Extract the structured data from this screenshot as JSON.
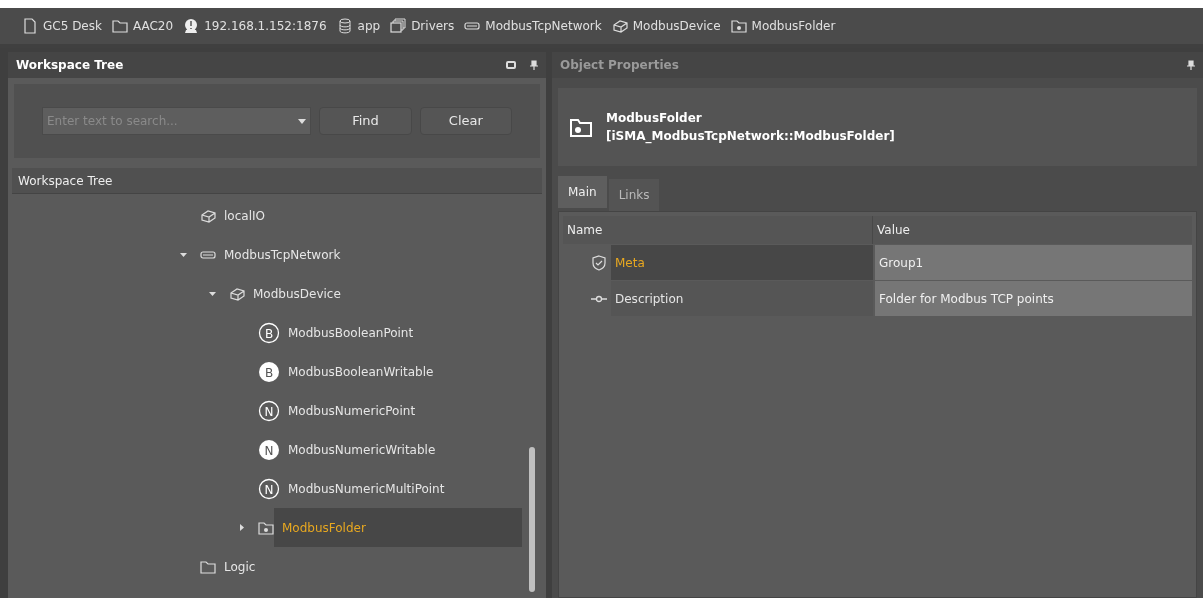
{
  "breadcrumb": [
    {
      "kind": "page",
      "label": "GC5 Desk"
    },
    {
      "kind": "folder",
      "label": "AAC20"
    },
    {
      "kind": "station",
      "label": "192.168.1.152:1876"
    },
    {
      "kind": "database",
      "label": "app"
    },
    {
      "kind": "drivers",
      "label": "Drivers"
    },
    {
      "kind": "network",
      "label": "ModbusTcpNetwork"
    },
    {
      "kind": "device",
      "label": "ModbusDevice"
    },
    {
      "kind": "modfolder",
      "label": "ModbusFolder"
    }
  ],
  "workspace_tree": {
    "title": "Workspace Tree",
    "search": {
      "placeholder": "Enter text to search..."
    },
    "find_button": "Find",
    "clear_button": "Clear",
    "column_header": "Workspace Tree",
    "items": [
      {
        "kind": "device",
        "label": "localIO",
        "selected": false
      },
      {
        "kind": "network",
        "label": "ModbusTcpNetwork",
        "expanded": true,
        "selected": false,
        "children": [
          {
            "kind": "device",
            "label": "ModbusDevice",
            "expanded": true,
            "selected": false,
            "children": [
              {
                "kind": "point",
                "badge": "B",
                "writable": false,
                "label": "ModbusBooleanPoint",
                "selected": false
              },
              {
                "kind": "point",
                "badge": "B",
                "writable": true,
                "label": "ModbusBooleanWritable",
                "selected": false
              },
              {
                "kind": "point",
                "badge": "N",
                "writable": false,
                "label": "ModbusNumericPoint",
                "selected": false
              },
              {
                "kind": "point",
                "badge": "N",
                "writable": true,
                "label": "ModbusNumericWritable",
                "selected": false
              },
              {
                "kind": "point",
                "badge": "N",
                "writable": false,
                "label": "ModbusNumericMultiPoint",
                "selected": false
              },
              {
                "kind": "modfolder",
                "label": "ModbusFolder",
                "expanded": false,
                "selected": true
              }
            ]
          }
        ]
      },
      {
        "kind": "folder",
        "label": "Logic",
        "selected": false
      }
    ]
  },
  "object_properties": {
    "title": "Object Properties",
    "object_name": "ModbusFolder",
    "object_type": "[iSMA_ModbusTcpNetwork::ModbusFolder]",
    "tabs": [
      {
        "label": "Main",
        "selected": true
      },
      {
        "label": "Links",
        "selected": false
      }
    ],
    "columns": [
      "Name",
      "Value"
    ],
    "rows": [
      {
        "kind": "meta",
        "name": "Meta",
        "value": "Group1",
        "selected": true
      },
      {
        "kind": "slot",
        "name": "Description",
        "value": "Folder for Modbus TCP points",
        "selected": false
      }
    ]
  }
}
